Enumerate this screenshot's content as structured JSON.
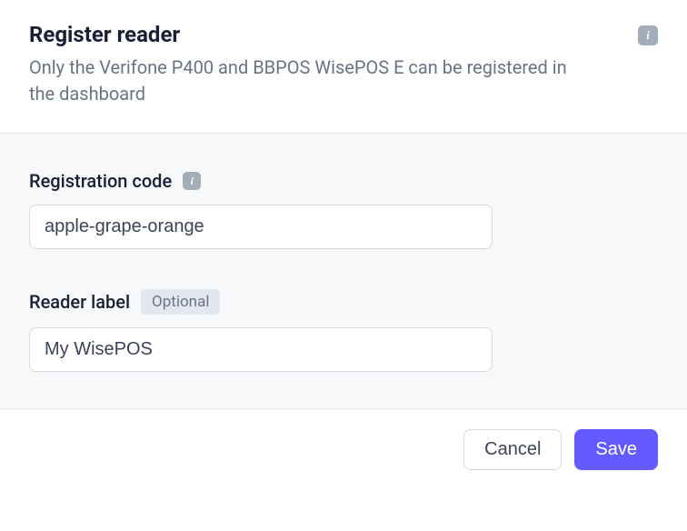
{
  "header": {
    "title": "Register reader",
    "subtitle": "Only the Verifone P400 and BBPOS WisePOS E can be registered in the dashboard"
  },
  "form": {
    "registration_code": {
      "label": "Registration code",
      "value": "apple-grape-orange"
    },
    "reader_label": {
      "label": "Reader label",
      "optional_text": "Optional",
      "value": "My WisePOS"
    }
  },
  "footer": {
    "cancel_label": "Cancel",
    "save_label": "Save"
  },
  "icons": {
    "info_glyph": "i"
  }
}
